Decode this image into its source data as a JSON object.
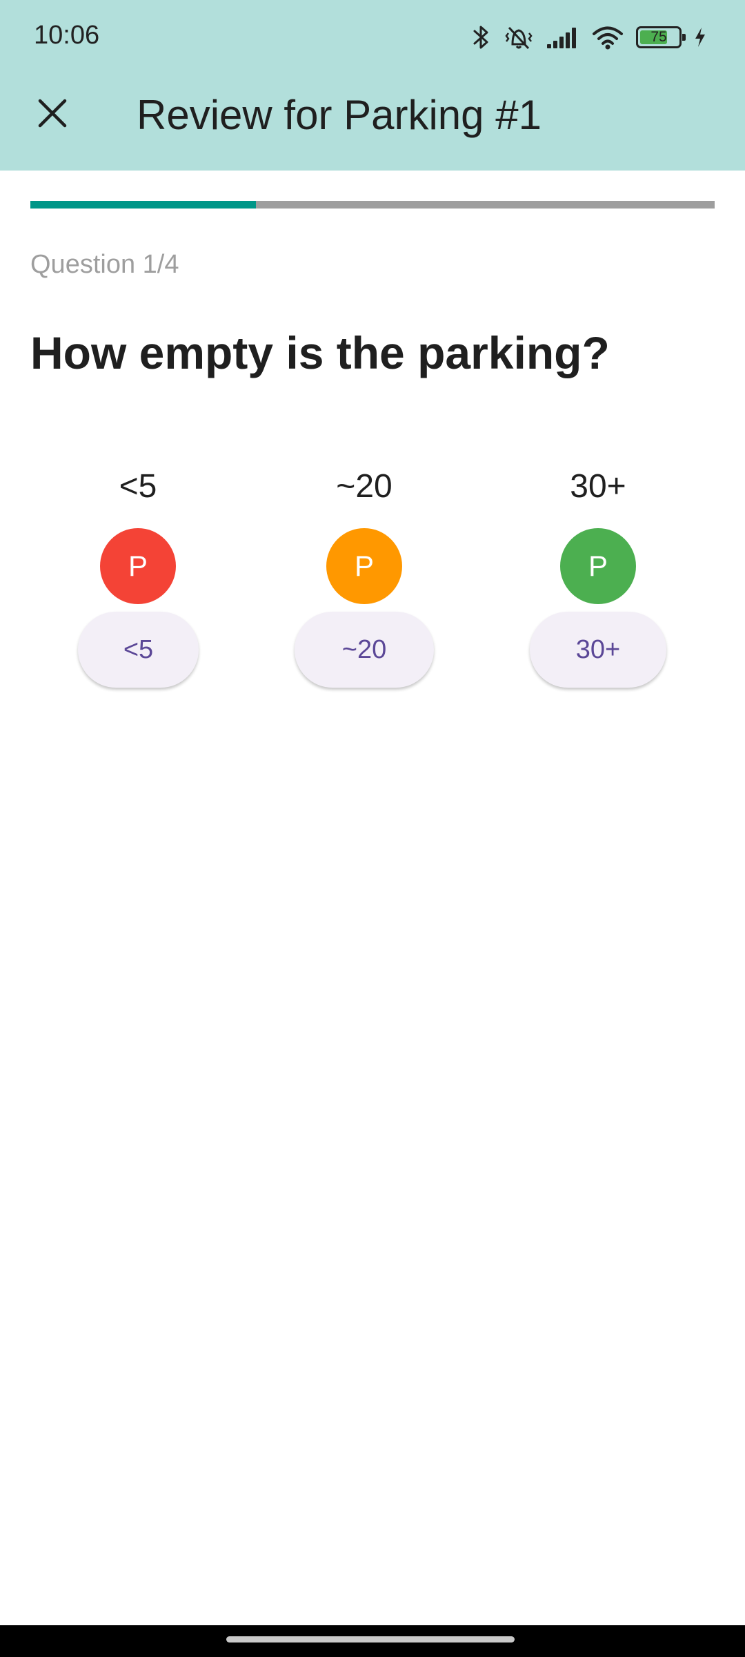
{
  "status_bar": {
    "time": "10:06",
    "battery_level": "75",
    "icons": [
      "bluetooth-icon",
      "vibrate-off-icon",
      "signal-icon",
      "wifi-icon",
      "battery-icon",
      "charging-bolt-icon"
    ]
  },
  "app_bar": {
    "title": "Review for Parking #1",
    "close_icon": "close-icon",
    "background": "#b2dfdb"
  },
  "progress": {
    "current": 1,
    "total": 4,
    "fraction": 0.33,
    "fill_color": "#009688",
    "track_color": "#9e9e9e"
  },
  "question": {
    "counter": "Question 1/4",
    "text": "How empty is the parking?"
  },
  "options": [
    {
      "label": "<5",
      "marker_text": "P",
      "marker_color": "#f44336",
      "button_label": "<5"
    },
    {
      "label": "~20",
      "marker_text": "P",
      "marker_color": "#ff9800",
      "button_label": "~20"
    },
    {
      "label": "30+",
      "marker_text": "P",
      "marker_color": "#4caf50",
      "button_label": "30+"
    }
  ],
  "colors": {
    "button_bg": "#f3eff7",
    "button_text": "#5b4797"
  }
}
